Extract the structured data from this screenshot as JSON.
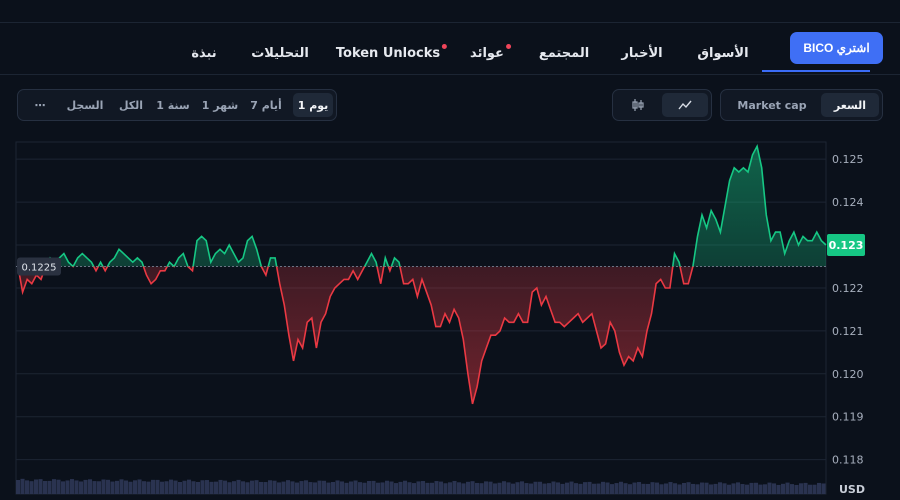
{
  "nav": {
    "buy_label": "اشتري BICO",
    "items": [
      {
        "label": "الأسواق",
        "dot": false
      },
      {
        "label": "الأخبار",
        "dot": false
      },
      {
        "label": "المجتمع",
        "dot": false
      },
      {
        "label": "عوائد",
        "dot": true
      },
      {
        "label": "Token Unlocks",
        "dot": true
      },
      {
        "label": "التحليلات",
        "dot": false
      },
      {
        "label": "نبذة",
        "dot": false
      }
    ]
  },
  "metric_toggle": {
    "options": [
      "السعر",
      "Market cap"
    ],
    "selected": "السعر"
  },
  "chart_style_toggle": {
    "options": [
      "line-chart-icon",
      "candlestick-icon"
    ],
    "selected": "line-chart-icon"
  },
  "range_selector": {
    "options": [
      "1 يوم",
      "7 أيام",
      "1 شهر",
      "1 سنة",
      "الكل",
      "السجل"
    ],
    "selected": "1 يوم",
    "more_label": "⋯"
  },
  "colors": {
    "up": "#16c784",
    "down": "#ea3943",
    "accent": "#3f6ff5",
    "volume": "#2a3350"
  },
  "chart_data": {
    "type": "area",
    "y_ticks": [
      0.118,
      0.119,
      0.12,
      0.121,
      0.122,
      0.123,
      0.124,
      0.125
    ],
    "y_tick_labels": [
      "0.118",
      "0.119",
      "0.120",
      "0.121",
      "0.122",
      "0.123",
      "0.124",
      "0.125"
    ],
    "ylim": [
      0.1172,
      0.1254
    ],
    "baseline": {
      "value": 0.1225,
      "label": "0.1225"
    },
    "current": {
      "value": 0.123,
      "label": "0.123"
    },
    "currency_label": "USD",
    "grid": true,
    "series": [
      {
        "values": [
          0.1225,
          0.1219,
          0.1222,
          0.1221,
          0.1223,
          0.1222,
          0.1225,
          0.1227,
          0.1226,
          0.1227,
          0.1228,
          0.1226,
          0.1225,
          0.1227,
          0.1228,
          0.1227,
          0.1226,
          0.1224,
          0.1226,
          0.1224,
          0.1226,
          0.1227,
          0.1229,
          0.1228,
          0.1227,
          0.1226,
          0.1227,
          0.1226,
          0.1223,
          0.1221,
          0.1222,
          0.1224,
          0.1224,
          0.1226,
          0.1225,
          0.1227,
          0.1228,
          0.1225,
          0.1224,
          0.1231,
          0.1232,
          0.1231,
          0.1226,
          0.1228,
          0.1229,
          0.1228,
          0.123,
          0.1228,
          0.1226,
          0.1227,
          0.1231,
          0.1232,
          0.1229,
          0.1225,
          0.1223,
          0.1227,
          0.1227,
          0.1221,
          0.1216,
          0.1209,
          0.1203,
          0.1208,
          0.1206,
          0.1212,
          0.1213,
          0.1206,
          0.1212,
          0.1214,
          0.1218,
          0.122,
          0.1221,
          0.1222,
          0.1222,
          0.1224,
          0.1222,
          0.1224,
          0.1226,
          0.1228,
          0.1226,
          0.1221,
          0.1227,
          0.1224,
          0.1227,
          0.1226,
          0.1221,
          0.1221,
          0.1222,
          0.1218,
          0.1222,
          0.1219,
          0.1216,
          0.1211,
          0.1211,
          0.1214,
          0.1212,
          0.1215,
          0.1213,
          0.1208,
          0.12,
          0.1193,
          0.1197,
          0.1203,
          0.1206,
          0.1209,
          0.1209,
          0.121,
          0.1213,
          0.1212,
          0.1212,
          0.1214,
          0.1212,
          0.1212,
          0.1219,
          0.122,
          0.1216,
          0.1218,
          0.1215,
          0.1212,
          0.1212,
          0.1211,
          0.1212,
          0.1213,
          0.1214,
          0.1212,
          0.1213,
          0.1214,
          0.121,
          0.1206,
          0.1207,
          0.1212,
          0.121,
          0.1205,
          0.1202,
          0.1204,
          0.1203,
          0.1206,
          0.1204,
          0.121,
          0.1214,
          0.1221,
          0.1222,
          0.122,
          0.122,
          0.1228,
          0.1226,
          0.1221,
          0.1221,
          0.1225,
          0.1232,
          0.1237,
          0.1234,
          0.1238,
          0.1236,
          0.1233,
          0.1239,
          0.1245,
          0.1248,
          0.1247,
          0.1248,
          0.1247,
          0.1251,
          0.1253,
          0.1248,
          0.1237,
          0.1231,
          0.1233,
          0.1233,
          0.1228,
          0.1231,
          0.1233,
          0.123,
          0.1232,
          0.1231,
          0.1231,
          0.1233,
          0.1231,
          0.123
        ]
      }
    ]
  }
}
